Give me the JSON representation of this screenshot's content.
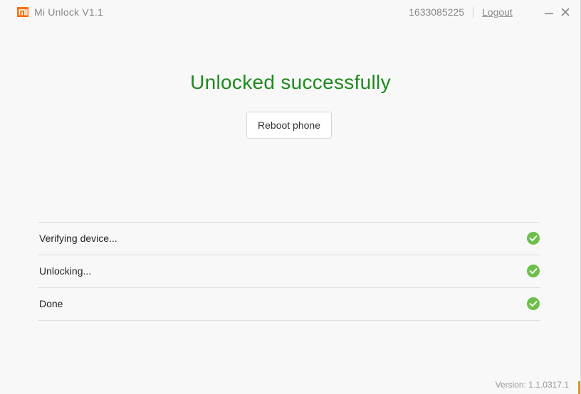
{
  "app": {
    "title": "Mi Unlock  V1.1",
    "brand_color": "#ff6a00"
  },
  "header": {
    "account_id": "1633085225",
    "logout_label": "Logout",
    "minimize_icon": "minimize-icon",
    "close_icon": "close-icon"
  },
  "main": {
    "headline": "Unlocked successfully",
    "headline_color": "#1e8a1e",
    "reboot_label": "Reboot phone"
  },
  "steps": [
    {
      "label": "Verifying device...",
      "status": "done",
      "icon": "check-circle-icon"
    },
    {
      "label": "Unlocking...",
      "status": "done",
      "icon": "check-circle-icon"
    },
    {
      "label": "Done",
      "status": "done",
      "icon": "check-circle-icon"
    }
  ],
  "status_color": "#6cc04a",
  "footer": {
    "version": "Version: 1.1.0317.1"
  }
}
